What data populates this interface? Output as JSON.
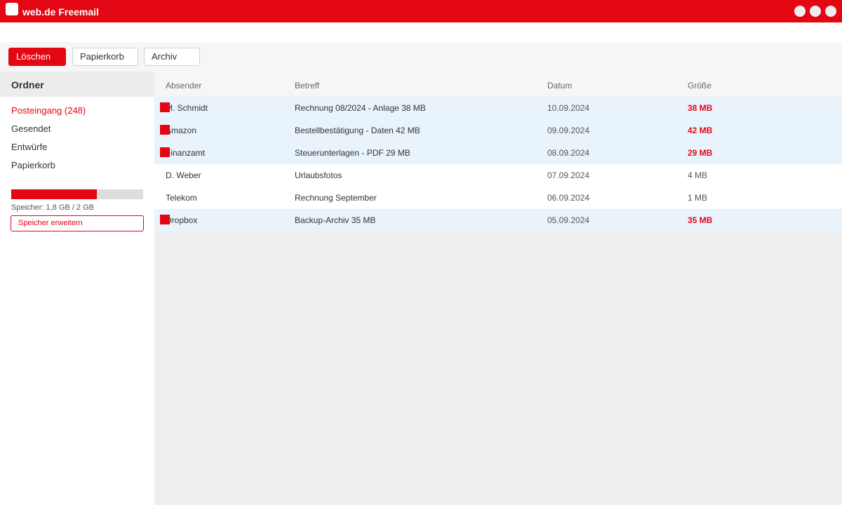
{
  "window": {
    "title": "web.de Freemail"
  },
  "toolbar": {
    "delete_label": "Löschen",
    "trash_label": "Papierkorb",
    "archive_label": "Archiv"
  },
  "sidebar": {
    "title": "Ordner",
    "folders": [
      "Posteingang (248)",
      "Gesendet",
      "Entwürfe",
      "Papierkorb"
    ],
    "storage": {
      "used_fraction": 0.65,
      "text": "Speicher: 1,8 GB / 2 GB",
      "expand_label": "Speicher erweitern"
    }
  },
  "list": {
    "columns": [
      "Absender",
      "Betreff",
      "Datum",
      "Größe"
    ],
    "rows": [
      {
        "sender": "M. Schmidt",
        "subject": "Rechnung 08/2024 - Anlage 38 MB",
        "date": "10.09.2024",
        "size": "38 MB",
        "flagged": true
      },
      {
        "sender": "Amazon",
        "subject": "Bestellbestätigung - Daten 42 MB",
        "date": "09.09.2024",
        "size": "42 MB",
        "flagged": true
      },
      {
        "sender": "Finanzamt",
        "subject": "Steuerunterlagen - PDF 29 MB",
        "date": "08.09.2024",
        "size": "29 MB",
        "flagged": true
      },
      {
        "sender": "D. Weber",
        "subject": "Urlaubsfotos",
        "date": "07.09.2024",
        "size": "4 MB",
        "flagged": false
      },
      {
        "sender": "Telekom",
        "subject": "Rechnung September",
        "date": "06.09.2024",
        "size": "1 MB",
        "flagged": false
      },
      {
        "sender": "Dropbox",
        "subject": "Backup-Archiv 35 MB",
        "date": "05.09.2024",
        "size": "35 MB",
        "flagged": true
      }
    ]
  },
  "colors": {
    "brand": "#e30613",
    "selected_row": "#e8f3fc"
  }
}
